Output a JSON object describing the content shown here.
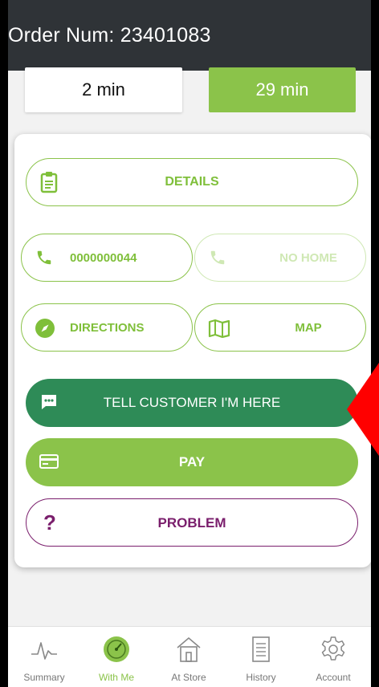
{
  "header": {
    "title": "Order Num: 23401083"
  },
  "timers": {
    "left": "2 min",
    "right": "29 min"
  },
  "actions": {
    "details": "DETAILS",
    "phone": "0000000044",
    "no_home": "NO HOME",
    "directions": "DIRECTIONS",
    "map": "MAP",
    "tell_customer": "TELL CUSTOMER I'M HERE",
    "pay": "PAY",
    "problem": "PROBLEM"
  },
  "nav": {
    "items": [
      {
        "label": "Summary"
      },
      {
        "label": "With Me"
      },
      {
        "label": "At Store"
      },
      {
        "label": "History"
      },
      {
        "label": "Account"
      }
    ]
  },
  "colors": {
    "header": "#2f3337",
    "accent_green": "#8bc34a",
    "dark_green": "#2e8b57",
    "purple": "#7a1e6c",
    "pointer": "#ff0000"
  }
}
